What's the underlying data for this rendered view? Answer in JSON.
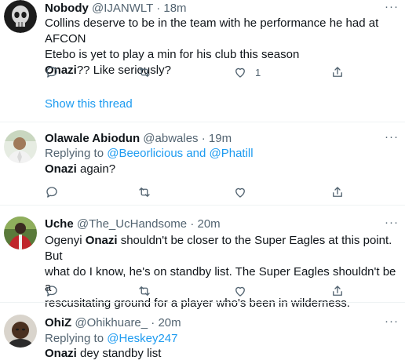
{
  "tweets": [
    {
      "name": "Nobody",
      "handle": "@IJANWLT",
      "dot": "·",
      "time": "18m",
      "lines": [
        "Collins deserve to be in the team with he performance he had at AFCON",
        "Etebo is yet to play a min for his club this season"
      ],
      "bold_word": "Onazi",
      "tail": "?? Like seriously?",
      "like_count": "1",
      "show_thread": "Show this thread"
    },
    {
      "name": "Olawale Abiodun",
      "handle": "@abwales",
      "dot": "·",
      "time": "19m",
      "replying_to": "Replying to",
      "mentions": "@Beeorlicious and @Phatill",
      "bold_word": "Onazi",
      "tail": " again?"
    },
    {
      "name": "Uche",
      "handle": "@The_UcHandsome",
      "dot": "·",
      "time": "20m",
      "pre": "Ogenyi ",
      "bold_word": "Onazi",
      "line1_tail": " shouldn't be closer to the Super Eagles at this point. But",
      "line2": "what do I know, he's on standby list. The Super Eagles shouldn't be a",
      "line3": "rescusitating ground for a player who's been in wilderness."
    },
    {
      "name": "OhiZ",
      "handle": "@Ohikhuare_",
      "dot": "·",
      "time": "20m",
      "replying_to": "Replying to",
      "mentions": "@Heskey247",
      "bold_word": "Onazi",
      "tail": " dey standby list"
    }
  ],
  "more_label": "···",
  "icons": [
    "reply-icon",
    "retweet-icon",
    "like-icon",
    "share-icon"
  ],
  "colors": {
    "accent": "#1d9bf0",
    "muted": "#536471",
    "text": "#0f1419",
    "divider": "#eff3f4"
  }
}
